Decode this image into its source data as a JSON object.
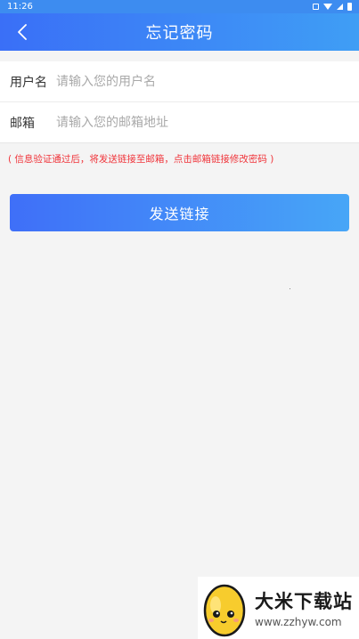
{
  "status_bar": {
    "time": "11:26",
    "icons": [
      "vibrate-icon",
      "wifi-icon",
      "signal-icon",
      "battery-icon"
    ]
  },
  "app_bar": {
    "back_icon": "chevron-left-icon",
    "title": "忘记密码"
  },
  "form": {
    "username": {
      "label": "用户名",
      "placeholder": "请输入您的用户名",
      "value": ""
    },
    "email": {
      "label": "邮箱",
      "placeholder": "请输入您的邮箱地址",
      "value": ""
    }
  },
  "hint": "( 信息验证通过后，将发送链接至邮箱，点击邮箱链接修改密码 )",
  "submit_label": "发送链接",
  "watermark": {
    "name": "大米下载站",
    "url": "www.zzhyw.com"
  },
  "colors": {
    "header_start": "#3a6ff7",
    "header_end": "#3f9ef5",
    "button_start": "#3f6ff8",
    "button_end": "#47a6f7",
    "hint_red": "#f0343a",
    "background": "#f4f4f4"
  }
}
